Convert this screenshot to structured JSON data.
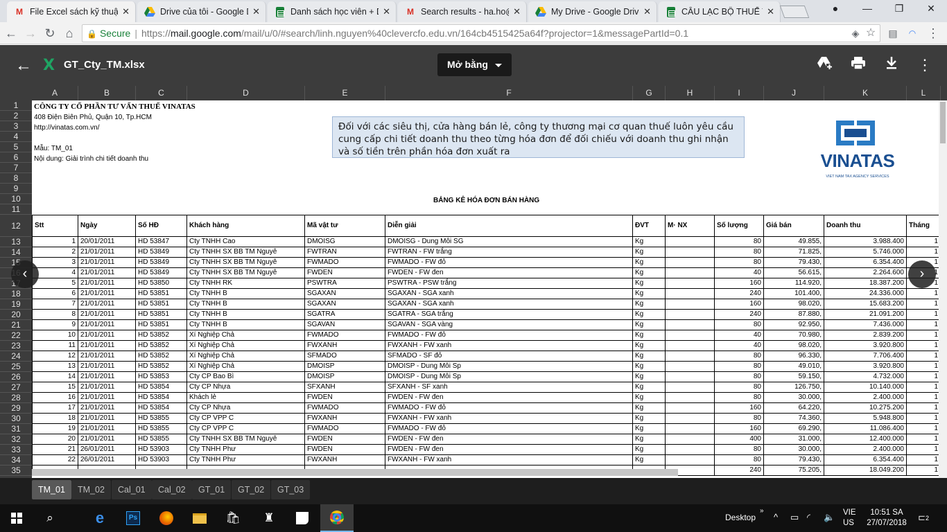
{
  "browser": {
    "tabs": [
      {
        "icon": "gmail-icon",
        "label": "File Excel sách kỹ thuật ·"
      },
      {
        "icon": "drive-icon",
        "label": "Drive của tôi - Google D"
      },
      {
        "icon": "sheets-icon",
        "label": "Danh sách học viên + D"
      },
      {
        "icon": "gmail-icon",
        "label": "Search results - ha.ho@"
      },
      {
        "icon": "drive-icon",
        "label": "My Drive - Google Drive"
      },
      {
        "icon": "sheets-icon",
        "label": "CÂU LẠC BỘ THUẾ TOÀ"
      }
    ],
    "secure_label": "Secure",
    "url_scheme": "https://",
    "url_host": "mail.google.com",
    "url_path": "/mail/u/0/#search/linh.nguyen%40clevercfo.edu.vn/164cb4515425a64f?projector=1&messagePartId=0.1"
  },
  "viewer": {
    "file_name": "GT_Cty_TM.xlsx",
    "open_with_label": "Mở bằng"
  },
  "sheet": {
    "columns": [
      "A",
      "B",
      "C",
      "D",
      "E",
      "F",
      "G",
      "H",
      "I",
      "J",
      "K",
      "L"
    ],
    "row_numbers": [
      "1",
      "2",
      "3",
      "4",
      "5",
      "6",
      "7",
      "8",
      "9",
      "10",
      "11",
      "12",
      "13",
      "14",
      "15",
      "16",
      "17",
      "18",
      "19",
      "20",
      "21",
      "22",
      "23",
      "24",
      "25",
      "26",
      "27",
      "28",
      "29",
      "30",
      "31",
      "32",
      "33",
      "34",
      "35"
    ],
    "company": "CÔNG TY CỔ PHẦN TƯ VẤN THUẾ VINATAS",
    "address": "408 Điện Biên Phủ, Quận 10, Tp.HCM",
    "website": "http://vinatas.com.vn/",
    "form": "Mẫu: TM_01",
    "content": "Nội dung: Giải trình chi tiết doanh thu",
    "note": "Đối với các siêu thị, cửa hàng bán lẻ, công ty thương mại cơ quan thuế luôn yêu cầu cung cấp chi tiết doanh thu theo từng hóa đơn để đối chiếu với doanh thu ghi nhận và số tiền trên phần hóa đơn xuất ra",
    "logo_name": "VINATAS",
    "logo_tagline": "VIET NAM TAX AGENCY SERVICES",
    "table_title": "BẢNG KÊ HÓA ĐƠN BÁN HÀNG",
    "headers": [
      "Stt",
      "Ngày",
      "Số HĐ",
      "Khách hàng",
      "Mã vật tư",
      "Diễn giải",
      "ĐVT",
      "M· NX",
      "Số lượng",
      "Giá bán",
      "Doanh thu",
      "Tháng"
    ],
    "rows": [
      [
        "1",
        "20/01/2011",
        "HD 53847",
        "Cty TNHH Cao",
        "DMOISG",
        "DMOISG - Dung Môi SG",
        "Kg",
        "",
        "80",
        "49.855,",
        "3.988.400",
        "1"
      ],
      [
        "2",
        "21/01/2011",
        "HD 53849",
        "Cty TNHH SX BB TM Nguyê",
        "FWTRAN",
        "FWTRAN - FW trắng",
        "Kg",
        "",
        "80",
        "71.825,",
        "5.746.000",
        "1"
      ],
      [
        "3",
        "21/01/2011",
        "HD 53849",
        "Cty TNHH SX BB TM Nguyê",
        "FWMADO",
        "FWMADO - FW đỏ",
        "Kg",
        "",
        "80",
        "79.430,",
        "6.354.400",
        "1"
      ],
      [
        "4",
        "21/01/2011",
        "HD 53849",
        "Cty TNHH SX BB TM Nguyê",
        "FWDEN",
        "FWDEN - FW đen",
        "Kg",
        "",
        "40",
        "56.615,",
        "2.264.600",
        "1"
      ],
      [
        "5",
        "21/01/2011",
        "HD 53850",
        "Cty TNHH RK",
        "PSWTRA",
        "PSWTRA - PSW trắng",
        "Kg",
        "",
        "160",
        "114.920,",
        "18.387.200",
        "1"
      ],
      [
        "6",
        "21/01/2011",
        "HD 53851",
        "Cty TNHH B",
        "SGAXAN",
        "SGAXAN - SGA xanh",
        "Kg",
        "",
        "240",
        "101.400,",
        "24.336.000",
        "1"
      ],
      [
        "7",
        "21/01/2011",
        "HD 53851",
        "Cty TNHH B",
        "SGAXAN",
        "SGAXAN - SGA xanh",
        "Kg",
        "",
        "160",
        "98.020,",
        "15.683.200",
        "1"
      ],
      [
        "8",
        "21/01/2011",
        "HD 53851",
        "Cty TNHH B",
        "SGATRA",
        "SGATRA - SGA trắng",
        "Kg",
        "",
        "240",
        "87.880,",
        "21.091.200",
        "1"
      ],
      [
        "9",
        "21/01/2011",
        "HD 53851",
        "Cty TNHH B",
        "SGAVAN",
        "SGAVAN - SGA vàng",
        "Kg",
        "",
        "80",
        "92.950,",
        "7.436.000",
        "1"
      ],
      [
        "10",
        "21/01/2011",
        "HD 53852",
        "Xí Nghiệp Chả",
        "FWMADO",
        "FWMADO - FW đỏ",
        "Kg",
        "",
        "40",
        "70.980,",
        "2.839.200",
        "1"
      ],
      [
        "11",
        "21/01/2011",
        "HD 53852",
        "Xí Nghiệp Chả",
        "FWXANH",
        "FWXANH - FW xanh",
        "Kg",
        "",
        "40",
        "98.020,",
        "3.920.800",
        "1"
      ],
      [
        "12",
        "21/01/2011",
        "HD 53852",
        "Xí Nghiệp Chả",
        "SFMADO",
        "SFMADO - SF đỏ",
        "Kg",
        "",
        "80",
        "96.330,",
        "7.706.400",
        "1"
      ],
      [
        "13",
        "21/01/2011",
        "HD 53852",
        "Xí Nghiệp Chả",
        "DMOISP",
        "DMOISP - Dung Môi Sp",
        "Kg",
        "",
        "80",
        "49.010,",
        "3.920.800",
        "1"
      ],
      [
        "14",
        "21/01/2011",
        "HD 53853",
        "Cty CP Bao Bì",
        "DMOISP",
        "DMOISP - Dung Môi Sp",
        "Kg",
        "",
        "80",
        "59.150,",
        "4.732.000",
        "1"
      ],
      [
        "15",
        "21/01/2011",
        "HD 53854",
        "Cty CP Nhựa",
        "SFXANH",
        "SFXANH - SF xanh",
        "Kg",
        "",
        "80",
        "126.750,",
        "10.140.000",
        "1"
      ],
      [
        "16",
        "21/01/2011",
        "HD 53854",
        "Khách lẻ",
        "FWDEN",
        "FWDEN - FW đen",
        "Kg",
        "",
        "80",
        "30.000,",
        "2.400.000",
        "1"
      ],
      [
        "17",
        "21/01/2011",
        "HD 53854",
        "Cty CP Nhựa",
        "FWMADO",
        "FWMADO - FW đỏ",
        "Kg",
        "",
        "160",
        "64.220,",
        "10.275.200",
        "1"
      ],
      [
        "18",
        "21/01/2011",
        "HD 53855",
        "Cty CP VPP C",
        "FWXANH",
        "FWXANH - FW xanh",
        "Kg",
        "",
        "80",
        "74.360,",
        "5.948.800",
        "1"
      ],
      [
        "19",
        "21/01/2011",
        "HD 53855",
        "Cty CP VPP C",
        "FWMADO",
        "FWMADO - FW đỏ",
        "Kg",
        "",
        "160",
        "69.290,",
        "11.086.400",
        "1"
      ],
      [
        "20",
        "21/01/2011",
        "HD 53855",
        "Cty TNHH SX BB TM Nguyê",
        "FWDEN",
        "FWDEN - FW đen",
        "Kg",
        "",
        "400",
        "31.000,",
        "12.400.000",
        "1"
      ],
      [
        "21",
        "26/01/2011",
        "HD 53903",
        "Cty TNHH Phư",
        "FWDEN",
        "FWDEN - FW đen",
        "Kg",
        "",
        "80",
        "30.000,",
        "2.400.000",
        "1"
      ],
      [
        "22",
        "26/01/2011",
        "HD 53903",
        "Cty TNHH Phư",
        "FWXANH",
        "FWXANH - FW xanh",
        "Kg",
        "",
        "80",
        "79.430,",
        "6.354.400",
        "1"
      ],
      [
        "",
        "",
        "",
        "",
        "",
        "",
        "",
        "",
        "240",
        "75.205,",
        "18.049.200",
        "1"
      ]
    ]
  },
  "sheet_tabs": [
    "TM_01",
    "TM_02",
    "Cal_01",
    "Cal_02",
    "GT_01",
    "GT_02",
    "GT_03"
  ],
  "taskbar": {
    "desktop_label": "Desktop",
    "lang_top": "VIE",
    "lang_bottom": "US",
    "time": "10:51 SA",
    "date": "27/07/2018",
    "notifications": "2"
  }
}
